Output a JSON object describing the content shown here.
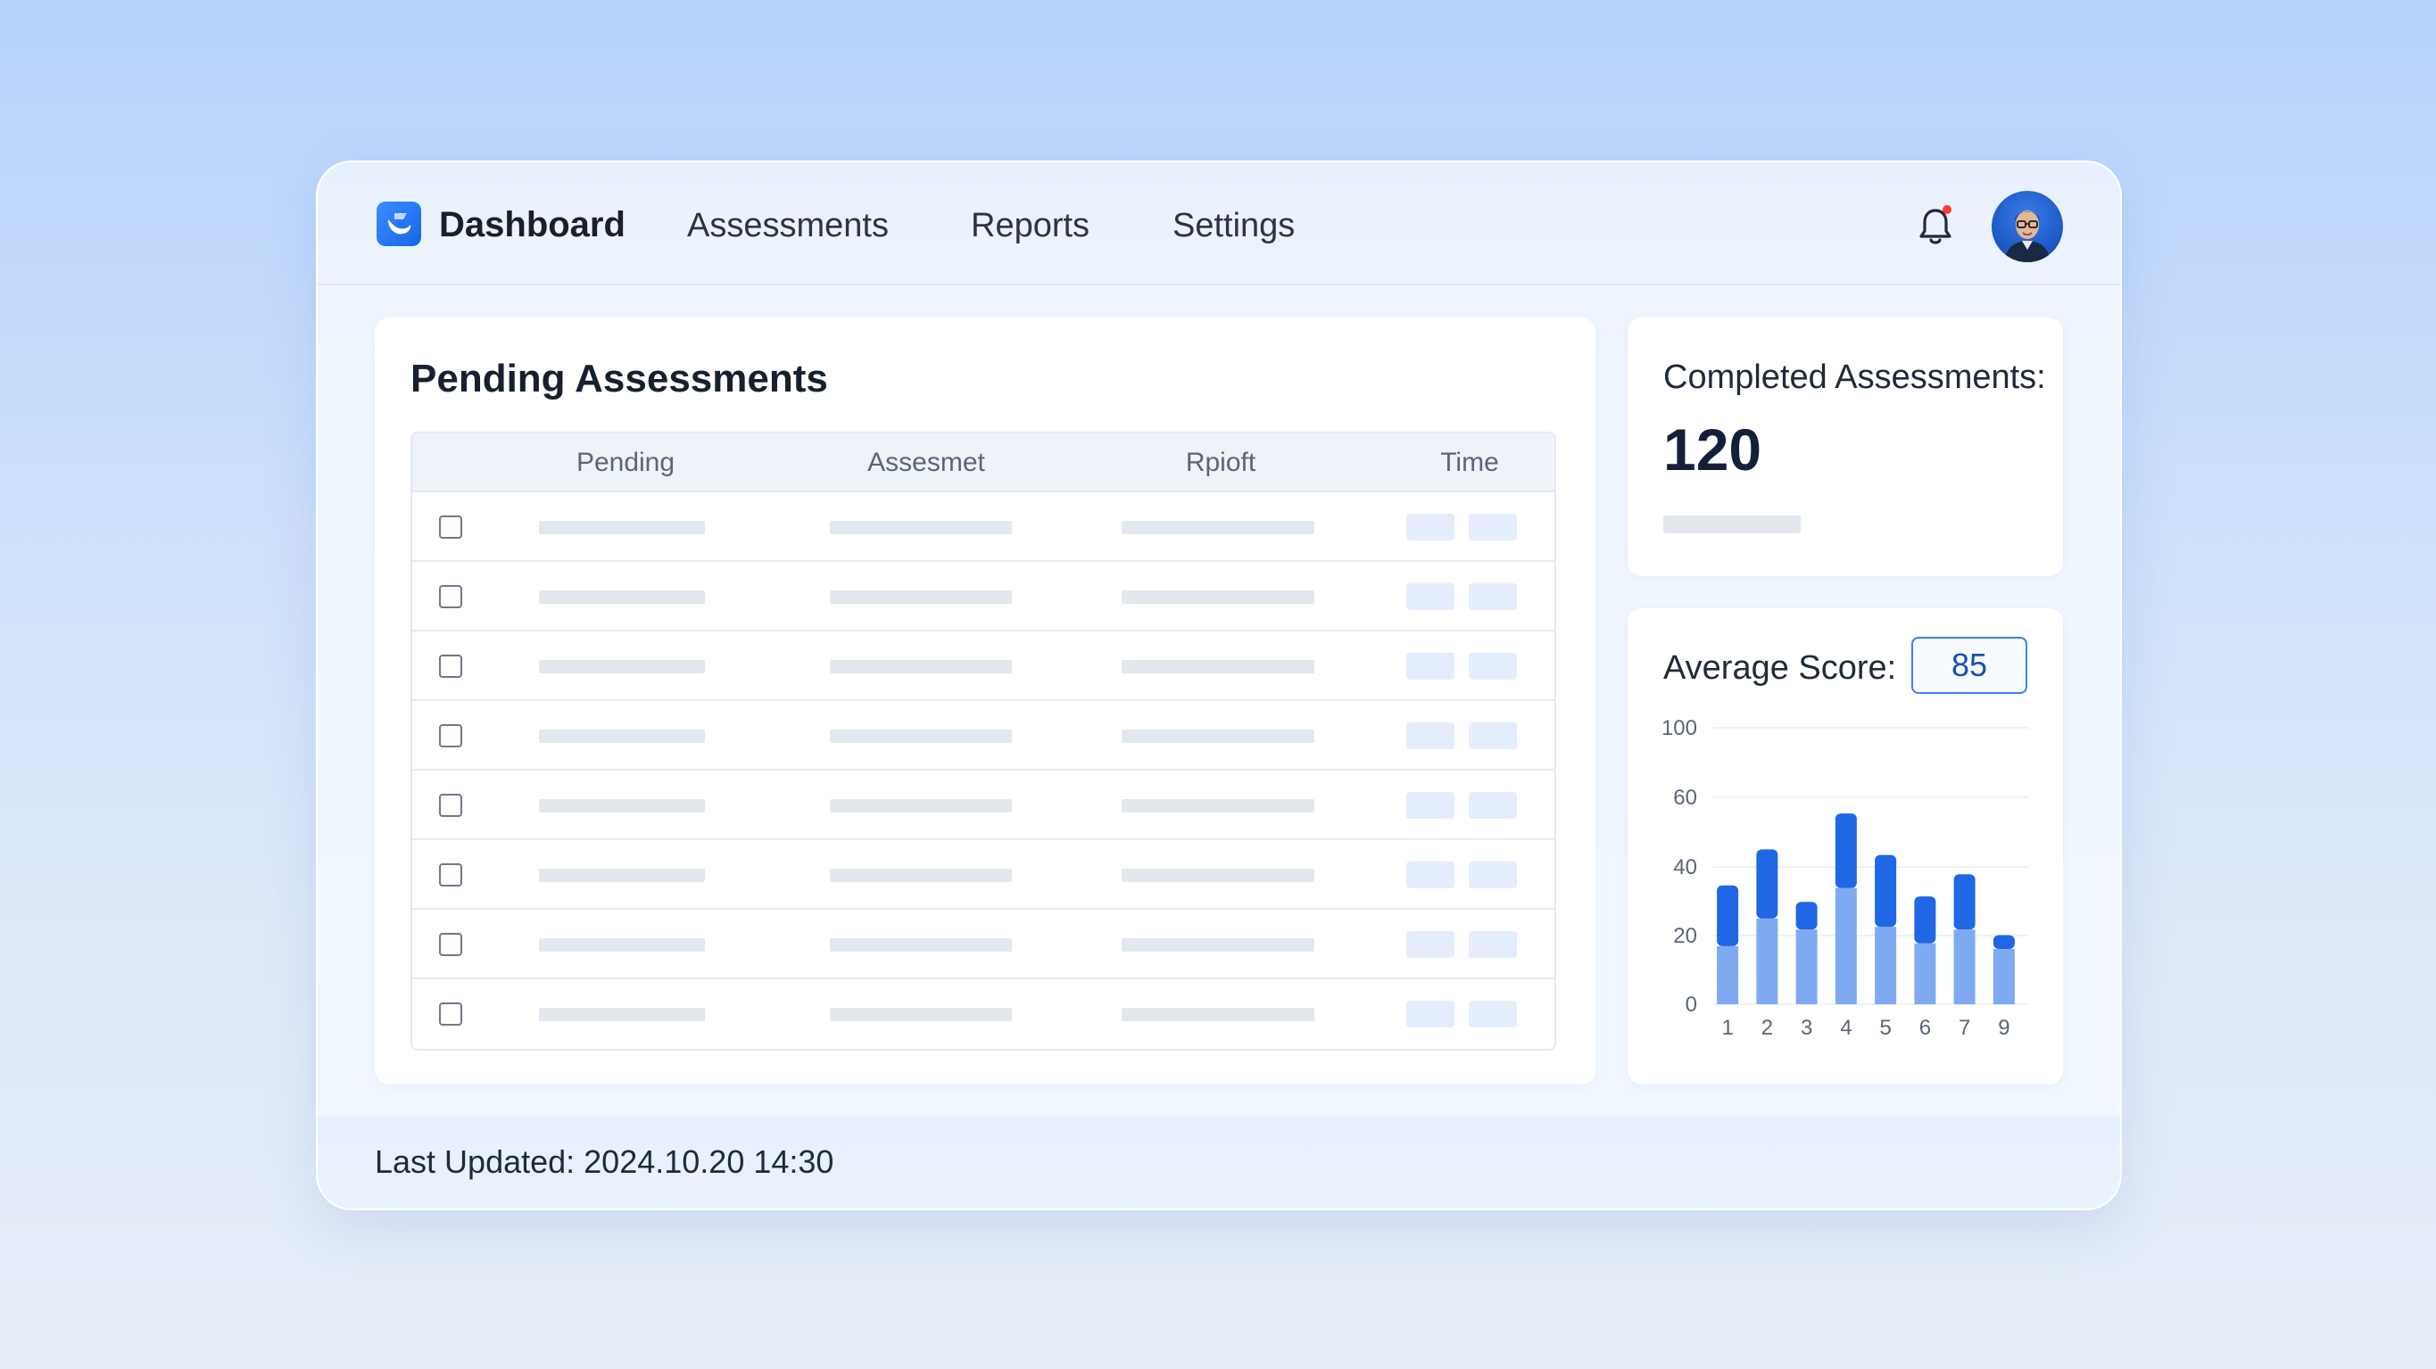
{
  "nav": {
    "brand": "Dashboard",
    "items": [
      {
        "label": "Assessments"
      },
      {
        "label": "Reports"
      },
      {
        "label": "Settings"
      }
    ],
    "notification_dot_color": "#ff3b30"
  },
  "pending": {
    "title": "Pending Assessments",
    "columns": [
      "Pending",
      "Assesmet",
      "Rpioft",
      "Time"
    ],
    "row_count": 8
  },
  "completed": {
    "label": "Completed Assessments:",
    "value": "120"
  },
  "score": {
    "label": "Average Score:",
    "value": "85"
  },
  "chart_data": {
    "type": "bar",
    "stacked": true,
    "categories": [
      "1",
      "2",
      "3",
      "4",
      "5",
      "6",
      "7",
      "9"
    ],
    "series": [
      {
        "color": "#7faaf2",
        "values": [
          21,
          31,
          27,
          42,
          28,
          22,
          27,
          20
        ]
      },
      {
        "color": "#1f67e4",
        "values": [
          22,
          25,
          10,
          27,
          26,
          17,
          20,
          5
        ]
      }
    ],
    "yticks": [
      "0",
      "20",
      "40",
      "60",
      "100"
    ],
    "ylim": [
      0,
      100
    ],
    "grid": true
  },
  "footer": {
    "last_updated": "Last Updated: 2024.10.20 14:30"
  },
  "colors": {
    "accent": "#1f67e4",
    "accent_light": "#7faaf2"
  }
}
